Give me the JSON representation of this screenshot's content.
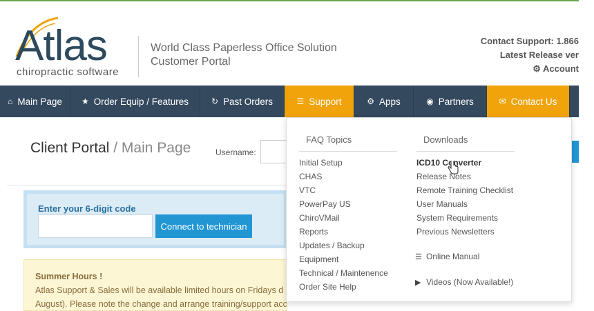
{
  "header": {
    "logo_text": "Atlas",
    "logo_subtext": "chiropractic software",
    "tagline_line1": "World Class Paperless Office Solution",
    "tagline_line2": "Customer Portal",
    "support_line1": "Contact Support: 1.866",
    "support_line2": "Latest Release ver",
    "support_line3": "Account",
    "account_icon": "gears-icon"
  },
  "nav": {
    "items": [
      {
        "label": "Main Page",
        "icon": "home-icon"
      },
      {
        "label": "Order Equip / Features",
        "icon": "star-icon"
      },
      {
        "label": "Past Orders",
        "icon": "refresh-icon"
      },
      {
        "label": "Support",
        "icon": "list-icon"
      },
      {
        "label": "Apps",
        "icon": "gear-icon"
      },
      {
        "label": "Partners",
        "icon": "globe-icon"
      },
      {
        "label": "Contact Us",
        "icon": "envelope-icon"
      }
    ]
  },
  "portal": {
    "title_main": "Client Portal",
    "title_sep": " / ",
    "title_sub": "Main Page",
    "username_label": "Username:"
  },
  "code_box": {
    "label": "Enter your 6-digit code",
    "input_value": "",
    "button_label": "Connect to technician"
  },
  "notice": {
    "title": "Summer Hours !",
    "line1": "Atlas Support & Sales will be available limited hours on Fridays d",
    "line2": "August). Please note the change and arrange training/support accordingly. Only our hours on"
  },
  "dropdown": {
    "faq_heading": "FAQ Topics",
    "faq_items": [
      "Initial Setup",
      "CHAS",
      "VTC",
      "PowerPay US",
      "ChiroVMail",
      "Reports",
      "Updates / Backup",
      "Equipment",
      "Technical / Maintenence",
      "Order Site Help"
    ],
    "downloads_heading": "Downloads",
    "download_items": [
      "ICD10 Converter",
      "Release Notes",
      "Remote Training Checklist",
      "User Manuals",
      "System Requirements",
      "Previous Newsletters"
    ],
    "online_manual": "Online Manual",
    "videos": "Videos (Now Available!)"
  },
  "colors": {
    "nav_bg": "#34495e",
    "nav_active": "#f0a30a",
    "button_blue": "#2196d3",
    "code_box_bg": "#dcecf7",
    "notice_bg": "#fcf6d5",
    "logo_text": "#2d4a5e"
  }
}
